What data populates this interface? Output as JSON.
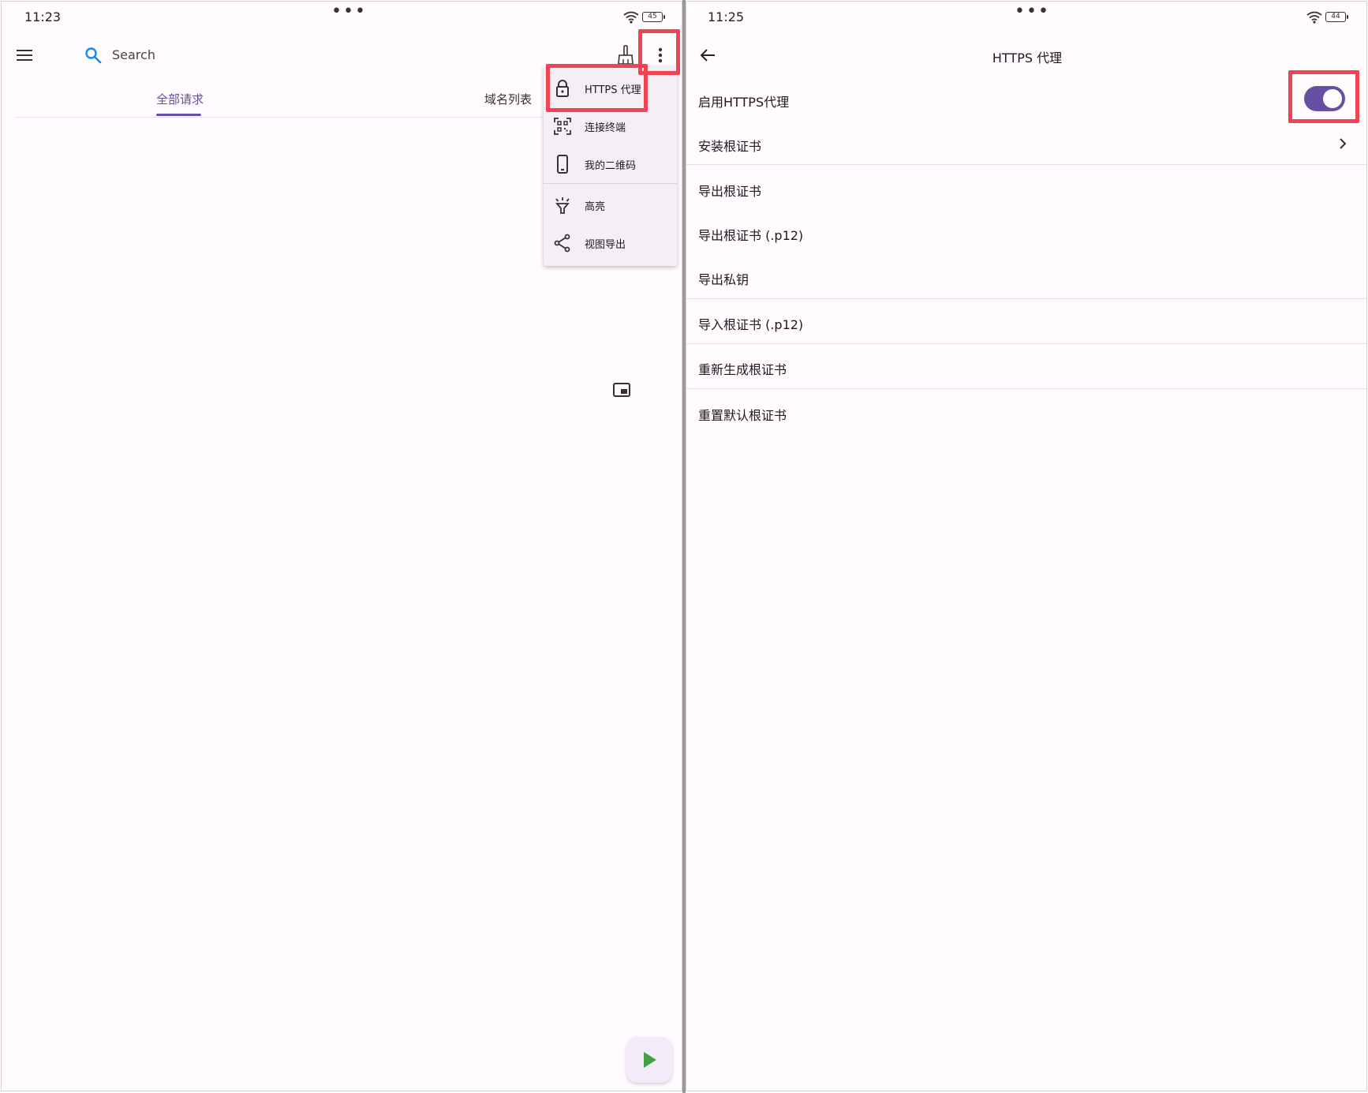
{
  "left": {
    "status": {
      "time": "11:23",
      "battery": "45"
    },
    "toolbar": {
      "search_placeholder": "Search"
    },
    "tabs": [
      {
        "label": "全部请求",
        "active": true
      },
      {
        "label": "域名列表",
        "active": false
      }
    ],
    "menu": {
      "items": [
        {
          "label": "HTTPS 代理",
          "icon": "lock-icon"
        },
        {
          "label": "连接终端",
          "icon": "qr-scan-icon"
        },
        {
          "label": "我的二维码",
          "icon": "phone-icon"
        },
        {
          "label": "高亮",
          "icon": "highlight-icon"
        },
        {
          "label": "视图导出",
          "icon": "share-icon"
        }
      ]
    }
  },
  "right": {
    "status": {
      "time": "11:25",
      "battery": "44"
    },
    "title": "HTTPS 代理",
    "settings": [
      {
        "label": "启用HTTPS代理",
        "control": "switch",
        "checked": true
      },
      {
        "label": "安装根证书",
        "control": "chevron"
      },
      {
        "label": "导出根证书"
      },
      {
        "label": "导出根证书 (.p12)"
      },
      {
        "label": "导出私钥"
      },
      {
        "label": "导入根证书 (.p12)"
      },
      {
        "label": "重新生成根证书"
      },
      {
        "label": "重置默认根证书"
      }
    ]
  },
  "colors": {
    "accent": "#6750a4",
    "highlight_box": "#f04452",
    "fab_play": "#43a047",
    "search_icon": "#1e88e5"
  }
}
